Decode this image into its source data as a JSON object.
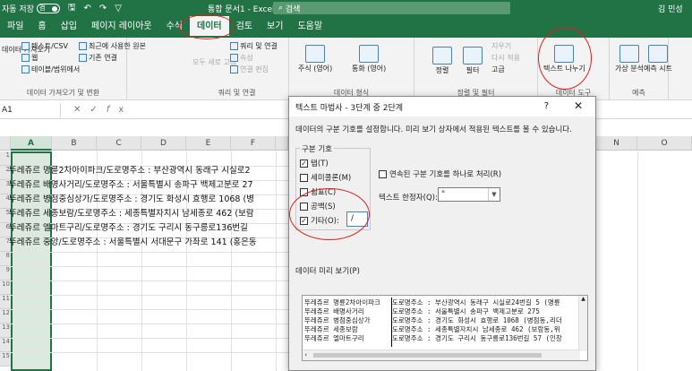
{
  "titlebar": {
    "autosave_label": "자동 저장",
    "autosave_state": "켬",
    "doc_title": "통합 문서1 - Excel",
    "search_placeholder": "검색",
    "user": "김 민성"
  },
  "tabs": [
    "파일",
    "홈",
    "삽입",
    "페이지 레이아웃",
    "수식",
    "데이터",
    "검토",
    "보기",
    "도움말"
  ],
  "active_tab": "데이터",
  "ribbon": {
    "get_data": "데이터 가져오기",
    "text_csv": "텍스트/CSV",
    "web": "웹",
    "from_table": "테이블/범위에서",
    "recent_sources": "최근에 사용한 원본",
    "existing_conn": "기존 연결",
    "group_get": "데이터 가져오기 및 변환",
    "refresh_all": "모두 새로 고침",
    "queries_conn": "쿼리 및 연결",
    "properties": "속성",
    "edit_links": "연결 편집",
    "group_queries": "쿼리 및 연결",
    "stocks": "주식 (영어)",
    "currencies": "통화 (영어)",
    "group_types": "데이터 형식",
    "sort": "정렬",
    "filter": "필터",
    "clear": "지우기",
    "reapply": "다시 적용",
    "advanced": "고급",
    "group_sort": "정렬 및 필터",
    "text_to_columns": "텍스트 나누기",
    "group_tools": "데이터 도구",
    "what_if": "가상 분석",
    "forecast_sheet": "예측 시트",
    "group_forecast": "예측"
  },
  "formula_bar": {
    "name_box": "A1",
    "icons": [
      "close-icon",
      "check-icon",
      "fx-icon"
    ]
  },
  "sheet": {
    "columns": [
      "A",
      "B",
      "C",
      "D",
      "E",
      "F",
      "N",
      "O"
    ],
    "row_numbers": [
      "1",
      "2",
      "3",
      "4",
      "5",
      "6",
      "7",
      "8",
      "9",
      "10",
      "11",
      "12",
      "13",
      "14",
      "15"
    ],
    "rows": [
      "뚜레쥬르 명륜2차아이파크/도로명주소 : 부산광역시 동래구 시실로2",
      "뚜레쥬르 배명사거리/도로명주소 : 서울특별시 송파구 백제고분로 27",
      "뚜레쥬르 병점중심상가/도로명주소 : 경기도 화성시 효행로 1068 (병",
      "뚜레쥬르 세종보람/도로명주소 : 세종특별자치시 남세종로 462 (보람",
      "뚜레쥬르 엘마트구리/도로명주소 : 경기도 구리시 동구릉로136번길 ",
      "뚜레쥬르 중앙/도로명주소 : 서울특별시 서대문구 가좌로 141 (홍은동"
    ]
  },
  "dialog": {
    "title": "텍스트 마법사 - 3단계 중 2단계",
    "help": "?",
    "close": "✕",
    "description": "데이터의 구분 기호를 설정합니다. 미리 보기 상자에서 적용된 텍스트를 볼 수 있습니다.",
    "delimiters_legend": "구분 기호",
    "tab": "탭(T)",
    "semicolon": "세미콜론(M)",
    "comma": "쉼표(C)",
    "space": "공백(S)",
    "other": "기타(O):",
    "other_value": "/",
    "consecutive": "연속된 구분 기호를 하나로 처리(R)",
    "qualifier_label": "텍스트 한정자(Q):",
    "qualifier_value": "\"",
    "preview_label": "데이터 미리 보기(P)",
    "preview_rows": [
      {
        "c1": "뚜레쥬르 명륜2차아이파크",
        "c2": "도로명주소 : 부산광역시 동래구 시실로24번길 5 (명륜"
      },
      {
        "c1": "뚜레쥬르 배명사거리",
        "c2": "도로명주소 : 서울특별시 송파구 백제고분로 275"
      },
      {
        "c1": "뚜레쥬르 병점중심상가",
        "c2": "도로명주소 : 경기도 화성시 효행로 1068 (병점동,리더"
      },
      {
        "c1": "뚜레쥬르 세종보람",
        "c2": "도로명주소 : 세종특별자치시 남세종로 462 (보람동,위"
      },
      {
        "c1": "뚜레쥬르 엘마트구리",
        "c2": "도로명주소 : 경기도 구리시 동구릉로136번길 57 (인창"
      }
    ]
  },
  "colors": {
    "excel_green": "#217346",
    "annotation_red": "#e0201a"
  }
}
